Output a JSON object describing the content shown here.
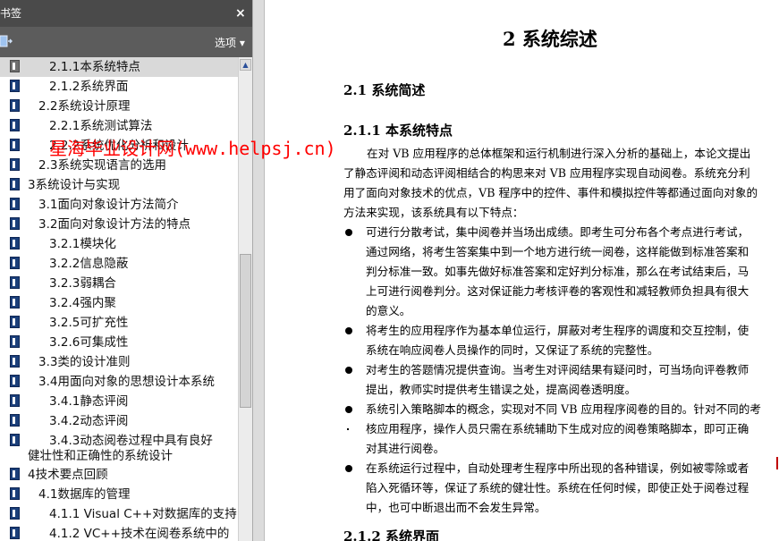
{
  "panel": {
    "title": "书签",
    "close": "×",
    "options_label": "选项 ▾",
    "items": [
      {
        "label": "2.1.1本系统特点"
      },
      {
        "label": "2.1.2系统界面"
      },
      {
        "label": "2.2系统设计原理"
      },
      {
        "label": "2.2.1系统测试算法"
      },
      {
        "label": "2.2.2系统优化分析和设计"
      },
      {
        "label": "2.3系统实现语言的选用"
      },
      {
        "label": "3系统设计与实现"
      },
      {
        "label": "3.1面向对象设计方法简介"
      },
      {
        "label": "3.2面向对象设计方法的特点"
      },
      {
        "label": "3.2.1模块化"
      },
      {
        "label": "3.2.2信息隐蔽"
      },
      {
        "label": "3.2.3弱耦合"
      },
      {
        "label": "3.2.4强内聚"
      },
      {
        "label": "3.2.5可扩充性"
      },
      {
        "label": "3.2.6可集成性"
      },
      {
        "label": "3.3类的设计准则"
      },
      {
        "label": "3.4用面向对象的思想设计本系统"
      },
      {
        "label": "3.4.1静态评阅"
      },
      {
        "label": "3.4.2动态评阅"
      },
      {
        "label": "3.4.3动态阅卷过程中具有良好"
      },
      {
        "label": "健壮性和正确性的系统设计"
      },
      {
        "label": "4技术要点回顾"
      },
      {
        "label": "4.1数据库的管理"
      },
      {
        "label": "4.1.1 Visual C++对数据库的支持"
      },
      {
        "label": "4.1.2 VC++技术在阅卷系统中的"
      }
    ]
  },
  "watermark": "星海毕业设计网(www.helpsj.cn)",
  "doc": {
    "chapter": "2  系统综述",
    "section": "2.1  系统简述",
    "subsection1": "2.1.1 本系统特点",
    "intro": [
      "在对 VB 应用程序的总体框架和运行机制进行深入分析的基础上，本论文提出",
      "了静态评阅和动态评阅相结合的构思来对 VB 应用程序实现自动阅卷。系统充分利",
      "用了面向对象技术的优点，VB 程序中的控件、事件和模拟控件等都通过面向对象的",
      "方法来实现，该系统具有以下特点："
    ],
    "bullets": [
      [
        "可进行分散考试，集中阅卷并当场出成绩。即考生可分布各个考点进行考试，",
        "通过网络，将考生答案集中到一个地方进行统一阅卷，这样能做到标准答案和",
        "判分标准一致。如事先做好标准答案和定好判分标准，那么在考试结束后，马",
        "上可进行阅卷判分。这对保证能力考核评卷的客观性和减轻教师负担具有很大",
        "的意义。"
      ],
      [
        "将考生的应用程序作为基本单位运行，屏蔽对考生程序的调度和交互控制，使",
        "系统在响应阅卷人员操作的同时，又保证了系统的完整性。"
      ],
      [
        "对考生的答题情况提供查询。当考生对评阅结果有疑问时，可当场向评卷教师",
        "提出，教师实时提供考生错误之处，提高阅卷透明度。"
      ],
      [
        "系统引入策略脚本的概念，实现对不同 VB 应用程序阅卷的目的。针对不同的考",
        "核应用程序，操作人员只需在系统辅助下生成对应的阅卷策略脚本，即可正确",
        "对其进行阅卷。"
      ],
      [
        "在系统运行过程中，自动处理考生程序中所出现的各种错误，例如被零除或者",
        "陷入死循环等，保证了系统的健壮性。系统在任何时候，即使正处于阅卷过程",
        "中，也可中断退出而不会发生异常。"
      ]
    ],
    "subsection2": "2.1.2 系统界面"
  }
}
